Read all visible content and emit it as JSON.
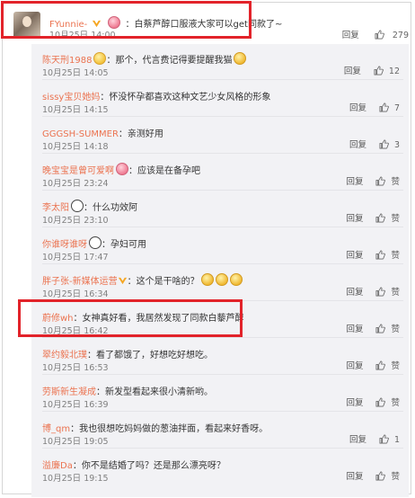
{
  "top_comment": {
    "username": "FYunnie-",
    "text": "：白蔡芦醇口服液大家可以get同款了~",
    "time": "10月25日 14:00",
    "reply_label": "回复",
    "likes": "279"
  },
  "replies": [
    {
      "username": "陈天刑1988",
      "text": "：那个，代言费记得要提醒我猫",
      "time": "10月25日 14:05",
      "reply_label": "回复",
      "likes": "12"
    },
    {
      "username": "sissy宝贝她妈",
      "text": "：怀没怀孕都喜欢这种文艺少女风格的形象",
      "time": "10月25日 14:15",
      "reply_label": "回复",
      "likes": "7"
    },
    {
      "username": "GGGSH-SUMMER",
      "text": "：亲测好用",
      "time": "10月25日 14:18",
      "reply_label": "回复",
      "likes": "3"
    },
    {
      "username": "晚宝宝是曾可爱啊",
      "text": "：应该是在备孕吧",
      "time": "10月25日 23:24",
      "reply_label": "回复",
      "likes": "赞"
    },
    {
      "username": "李太阳",
      "text": "：什么功效阿",
      "time": "10月25日 23:10",
      "reply_label": "回复",
      "likes": "赞"
    },
    {
      "username": "你谁呀谁呀",
      "text": "：孕妇可用",
      "time": "10月25日 17:47",
      "reply_label": "回复",
      "likes": "赞"
    },
    {
      "username": "胖子张-新媒体运营",
      "text": "：这个是干啥的？",
      "time": "10月25日 16:34",
      "reply_label": "回复",
      "likes": "赞"
    },
    {
      "username": "蔚修wh",
      "text": "：女神真好看，我居然发现了同款白藜芦醇",
      "time": "10月25日 16:42",
      "reply_label": "回复",
      "likes": "赞"
    },
    {
      "username": "翠约毅北璞",
      "text": "：看了都饿了，好想吃好想吃。",
      "time": "10月25日 16:53",
      "reply_label": "回复",
      "likes": "赞"
    },
    {
      "username": "劳斯新生凝成",
      "text": "：新发型看起来很小清新哟。",
      "time": "10月25日 16:39",
      "reply_label": "回复",
      "likes": "赞"
    },
    {
      "username": "博_qm",
      "text": "：我也很想吃妈妈做的葱油拌面，看起来好香呀。",
      "time": "10月25日 19:05",
      "reply_label": "回复",
      "likes": "1"
    },
    {
      "username": "溢廉Da",
      "text": "：你不是结婚了吗？还是那么漂亮呀？",
      "time": "10月25日 19:15",
      "reply_label": "回复",
      "likes": "赞"
    }
  ]
}
